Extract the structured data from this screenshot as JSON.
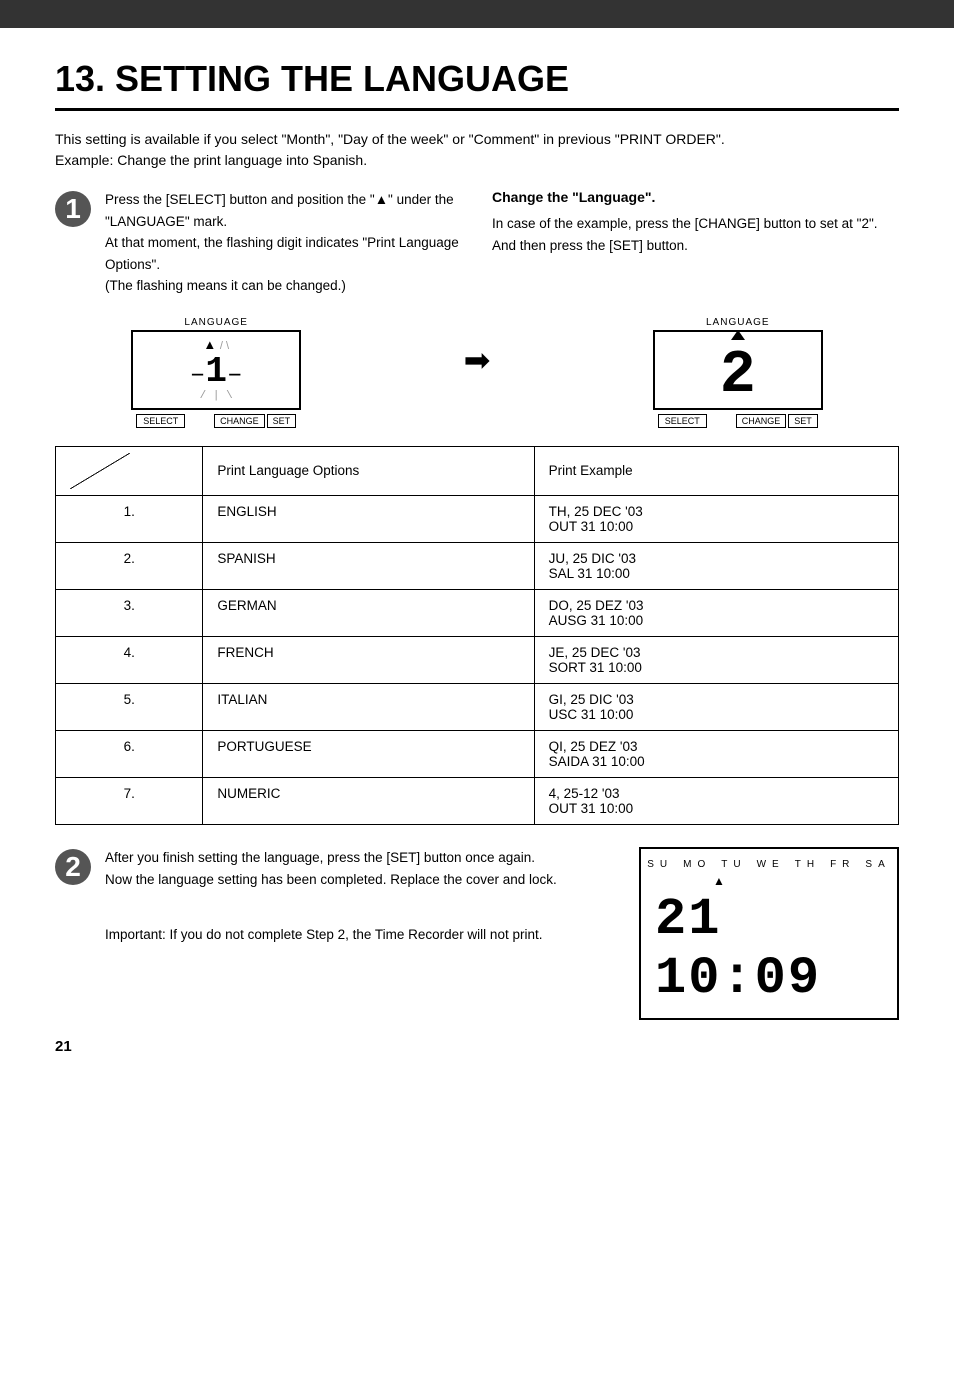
{
  "topBar": {},
  "page": {
    "title": "13. SETTING THE LANGUAGE",
    "intro1": "This setting is available if you select \"Month\", \"Day of the week\" or \"Comment\" in previous \"PRINT ORDER\".",
    "intro2": "Example: Change the print language into Spanish.",
    "step1": {
      "number": "1",
      "text1": "Press the [SELECT] button and position the \"▲\" under the \"LANGUAGE\" mark.",
      "text2": "At that moment, the flashing digit indicates \"Print Language Options\".",
      "text3": "(The flashing means it can be changed.)",
      "rightTitle": "Change the \"Language\".",
      "rightText1": "In case of the example, press the [CHANGE] button to set at \"2\".",
      "rightText2": "And then press the [SET] button."
    },
    "lcd1": {
      "label": "LANGUAGE",
      "buttons": {
        "left": "SELECT",
        "mid": "CHANGE",
        "right": "SET"
      }
    },
    "lcd2": {
      "label": "LANGUAGE",
      "value": "2",
      "buttons": {
        "left": "SELECT",
        "mid": "CHANGE",
        "right": "SET"
      }
    },
    "table": {
      "headers": [
        "",
        "Print Language Options",
        "Print Example"
      ],
      "rows": [
        {
          "num": "1.",
          "lang": "ENGLISH",
          "example": "TH, 25 DEC '03\nOUT 31 10:00"
        },
        {
          "num": "2.",
          "lang": "SPANISH",
          "example": "JU, 25 DIC '03\nSAL 31 10:00"
        },
        {
          "num": "3.",
          "lang": "GERMAN",
          "example": "DO, 25 DEZ '03\nAUSG 31 10:00"
        },
        {
          "num": "4.",
          "lang": "FRENCH",
          "example": "JE, 25 DEC '03\nSORT 31 10:00"
        },
        {
          "num": "5.",
          "lang": "ITALIAN",
          "example": "GI, 25 DIC '03\nUSC 31 10:00"
        },
        {
          "num": "6.",
          "lang": "PORTUGUESE",
          "example": "QI, 25 DEZ '03\nSAIDA 31 10:00"
        },
        {
          "num": "7.",
          "lang": "NUMERIC",
          "example": "4, 25-12 '03\nOUT 31 10:00"
        }
      ]
    },
    "step2": {
      "number": "2",
      "text1": "After you finish setting the language, press the [SET] button once again.",
      "text2": "Now the language setting has been completed. Replace the cover and lock.",
      "importantText": "Important: If you do not complete Step 2, the Time Recorder will  not print.",
      "clock": {
        "days": [
          "SU",
          "MO",
          "TU",
          "WE",
          "TH",
          "FR",
          "SA"
        ],
        "time": "21 10:09"
      }
    },
    "pageNumber": "21"
  }
}
